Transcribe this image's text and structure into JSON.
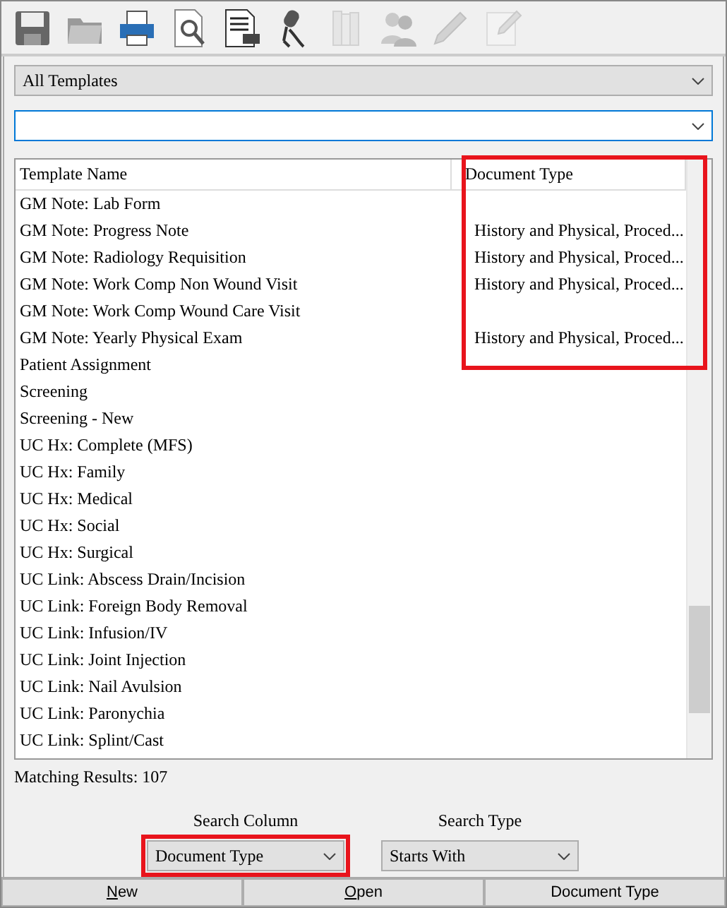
{
  "toolbar": [
    {
      "kind": "save",
      "disabled": false
    },
    {
      "kind": "folder",
      "disabled": false
    },
    {
      "kind": "printer",
      "disabled": false
    },
    {
      "kind": "preview",
      "disabled": false
    },
    {
      "kind": "document",
      "disabled": false
    },
    {
      "kind": "microphone",
      "disabled": false
    },
    {
      "kind": "binders",
      "disabled": true
    },
    {
      "kind": "users",
      "disabled": true
    },
    {
      "kind": "pencil",
      "disabled": true
    },
    {
      "kind": "note",
      "disabled": true
    }
  ],
  "template_filter": {
    "value": "All Templates"
  },
  "table": {
    "columns": [
      {
        "label": "Template Name"
      },
      {
        "label": "Document Type",
        "highlighted": true
      }
    ],
    "rows": [
      [
        "GM Note: Lab Form",
        ""
      ],
      [
        "GM Note: Progress Note",
        "History and Physical, Proced..."
      ],
      [
        "GM Note: Radiology Requisition",
        "History and Physical, Proced..."
      ],
      [
        "GM Note: Work Comp Non Wound Visit",
        "History and Physical, Proced..."
      ],
      [
        "GM Note: Work Comp Wound Care Visit",
        ""
      ],
      [
        "GM Note: Yearly Physical Exam",
        "History and Physical, Proced..."
      ],
      [
        "Patient Assignment",
        ""
      ],
      [
        "Screening",
        ""
      ],
      [
        "Screening - New",
        ""
      ],
      [
        "UC Hx: Complete (MFS)",
        ""
      ],
      [
        "UC Hx: Family",
        ""
      ],
      [
        "UC Hx: Medical",
        ""
      ],
      [
        "UC Hx: Social",
        ""
      ],
      [
        "UC Hx: Surgical",
        ""
      ],
      [
        "UC Link: Abscess Drain/Incision",
        ""
      ],
      [
        "UC Link: Foreign Body Removal",
        ""
      ],
      [
        "UC Link: Infusion/IV",
        ""
      ],
      [
        "UC Link: Joint Injection",
        ""
      ],
      [
        "UC Link: Nail Avulsion",
        ""
      ],
      [
        "UC Link: Paronychia",
        ""
      ],
      [
        "UC Link: Splint/Cast",
        ""
      ]
    ]
  },
  "matching_results": "Matching Results: 107",
  "search_column": {
    "label": "Search Column",
    "value": "Document Type",
    "highlighted": true
  },
  "search_type": {
    "label": "Search Type",
    "value": "Starts With",
    "highlighted": false
  },
  "buttons": [
    {
      "label": "New",
      "underline_first": true
    },
    {
      "label": "Open",
      "underline_first": true
    },
    {
      "label": "Document Type",
      "underline_first": false
    }
  ]
}
